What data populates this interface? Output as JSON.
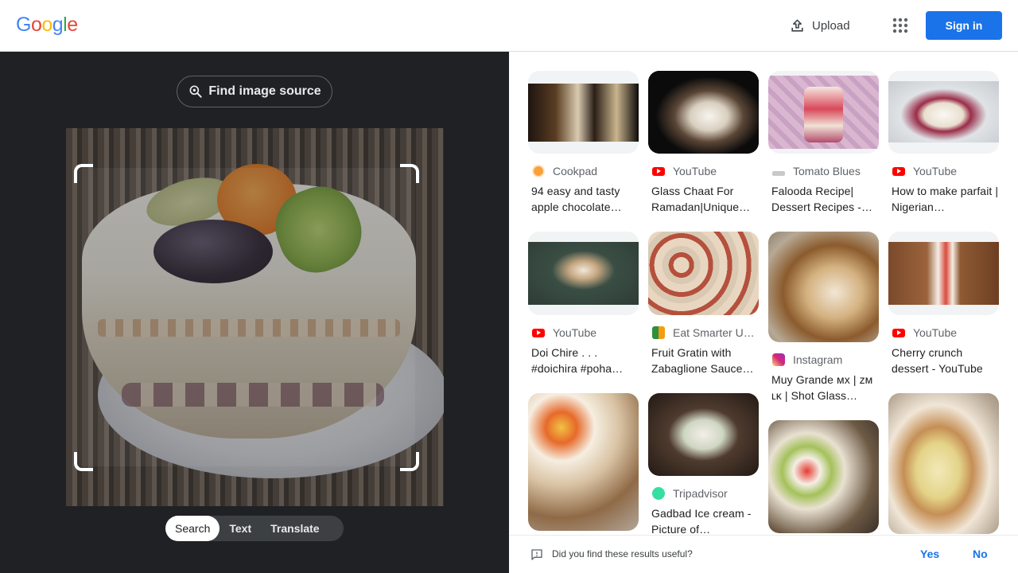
{
  "header": {
    "logo": [
      "G",
      "o",
      "o",
      "g",
      "l",
      "e"
    ],
    "upload_label": "Upload",
    "signin_label": "Sign in"
  },
  "lens": {
    "find_source_label": "Find image source",
    "modes": [
      {
        "label": "Search",
        "active": true
      },
      {
        "label": "Text",
        "active": false
      },
      {
        "label": "Translate",
        "active": false
      }
    ]
  },
  "results": [
    {
      "source": "Cookpad",
      "title": "94 easy and tasty apple chocolate…"
    },
    {
      "source": "YouTube",
      "title": "Glass Chaat For Ramadan|Unique…"
    },
    {
      "source": "Tomato Blues",
      "title": "Falooda Recipe| Dessert Recipes -…"
    },
    {
      "source": "YouTube",
      "title": "How to make parfait | Nigerian…"
    },
    {
      "source": "YouTube",
      "title": "Doi Chire . . . #doichira #poha…"
    },
    {
      "source": "Eat Smarter U…",
      "title": "Fruit Gratin with Zabaglione Sauce…"
    },
    {
      "source": "Instagram",
      "title": "Muy Grande ᴍx | ᴢᴍ ʟᴋ | Shot Glass…"
    },
    {
      "source": "YouTube",
      "title": "Cherry crunch dessert - YouTube"
    },
    {
      "source": "Tripadvisor",
      "title": "Gadbad Ice cream - Picture of…"
    }
  ],
  "feedback": {
    "question": "Did you find these results useful?",
    "yes": "Yes",
    "no": "No"
  },
  "colors": {
    "accent": "#1a73e8",
    "panel_dark": "#202124",
    "youtube": "#ff0000"
  }
}
